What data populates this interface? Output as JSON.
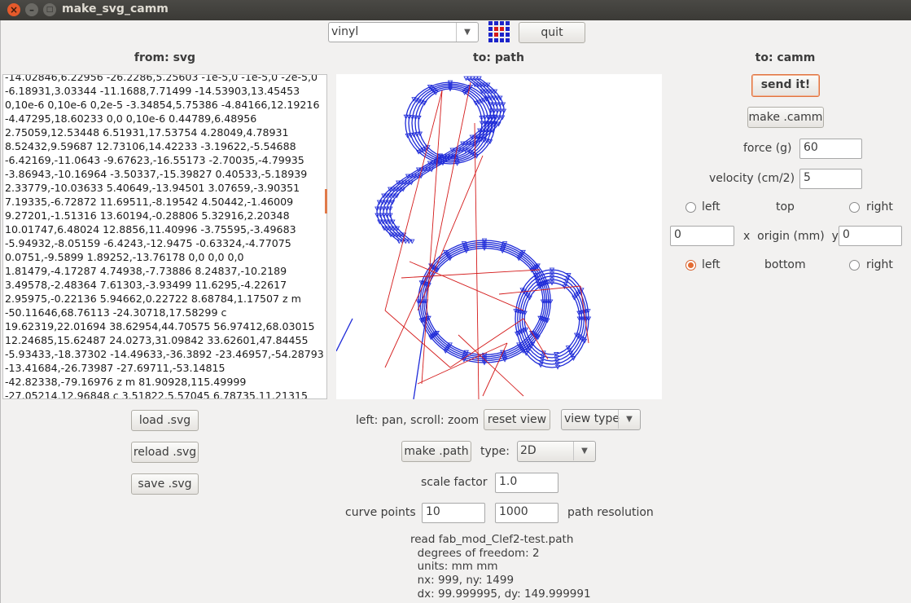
{
  "window": {
    "title": "make_svg_camm"
  },
  "toolbar": {
    "material": "vinyl",
    "quit_label": "quit"
  },
  "headers": {
    "from": "from: svg",
    "to_path": "to: path",
    "to_camm": "to: camm"
  },
  "svg_text": [
    "-14.02846,6.22956 -26.2286,5.25603 -1e-5,0 -1e-5,0 -2e-5,0",
    "-6.18931,3.03344 -11.1688,7.71499 -14.53903,13.45453",
    "0,10e-6 0,10e-6 0,2e-5 -3.34854,5.75386 -4.84166,12.19216",
    "-4.47295,18.60233 0,0 0,10e-6 0.44789,6.48956",
    "2.75059,12.53448 6.51931,17.53754 4.28049,4.78931",
    "8.52432,9.59687 12.73106,14.42233 -3.19622,-5.54688",
    "-6.42169,-11.0643 -9.67623,-16.55173 -2.70035,-4.79935",
    "-3.86943,-10.16964 -3.50337,-15.39827 0.40533,-5.18939",
    "2.33779,-10.03633 5.40649,-13.94501 3.07659,-3.90351",
    "7.19335,-6.72872 11.69511,-8.19542 4.50442,-1.46009",
    "9.27201,-1.51316 13.60194,-0.28806 5.32916,2.20348",
    "10.01747,6.48024 12.8856,11.40996 -3.75595,-3.49683",
    "-5.94932,-8.05159 -6.4243,-12.9475 -0.63324,-4.77075",
    "0.0751,-9.5899 1.89252,-13.76178 0,0 0,0 0,0",
    "1.81479,-4.17287 4.74938,-7.73886 8.24837,-10.2189",
    "3.49578,-2.48364 7.61303,-3.93499 11.6295,-4.22617",
    "2.95975,-0.22136 5.94662,0.22722 8.68784,1.17507 z m",
    "-50.11646,68.76113 -24.30718,17.58299 c",
    "19.62319,22.01694 38.62954,44.70575 56.97412,68.03015",
    "12.24685,15.62487 24.0273,31.09842 33.62601,47.84455",
    "-5.93433,-18.37302 -14.49633,-36.3892 -23.46957,-54.28793",
    "-13.41684,-26.73987 -27.69711,-53.14815",
    "-42.82338,-79.16976 z m 81.90928,115.49999",
    "-27.05214,12.96848 c 3.51822,5.57045 6.78735,11.21315"
  ],
  "svg_buttons": {
    "load": "load .svg",
    "reload": "reload .svg",
    "save": "save .svg"
  },
  "path_controls": {
    "nav_hint": "left: pan, scroll: zoom",
    "reset_view": "reset view",
    "view_type": "view type",
    "make_path": "make .path",
    "type_label": "type:",
    "type_value": "2D",
    "scale_label": "scale factor",
    "scale_value": "1.0",
    "curve_label": "curve points",
    "curve_value": "10",
    "resolution_value": "1000",
    "resolution_label": "path resolution"
  },
  "info": {
    "line1": "read fab_mod_Clef2-test.path",
    "line2": "  degrees of freedom: 2",
    "line3": "  units: mm mm",
    "line4": "  nx: 999, ny: 1499",
    "line5": "  dx: 99.999995, dy: 149.999991"
  },
  "camm": {
    "send_label": "send it!",
    "make_label": "make .camm",
    "force_label": "force (g)",
    "force_value": "60",
    "velocity_label": "velocity (cm/2)",
    "velocity_value": "5",
    "left_label": "left",
    "top_label": "top",
    "right_label": "right",
    "origin_x": "0",
    "origin_label": "x  origin (mm)  y",
    "origin_y": "0",
    "bottom_label": "bottom",
    "selected_origin": "left bottom"
  },
  "colors": {
    "path_blue": "#1f2bd8",
    "path_red": "#d41a1a",
    "accent": "#e46c33"
  }
}
